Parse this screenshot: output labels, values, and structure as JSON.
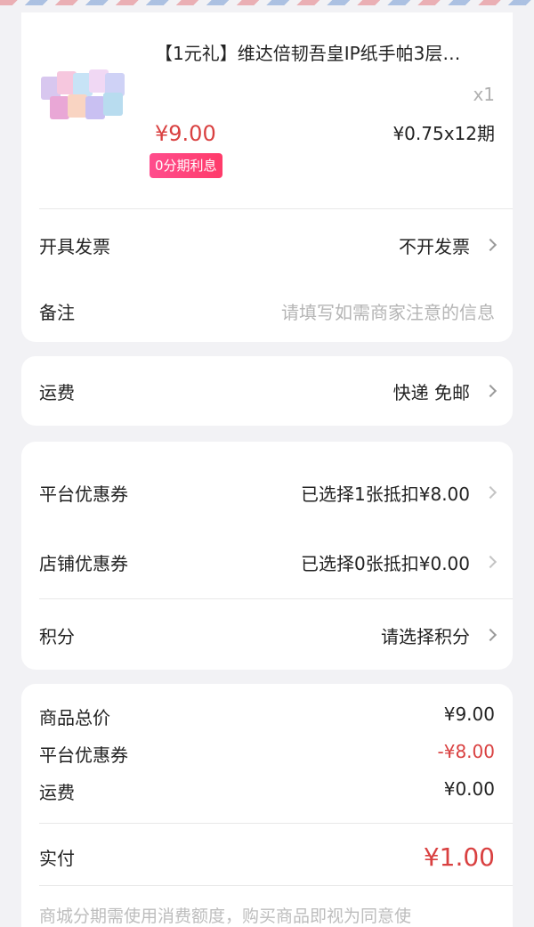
{
  "product": {
    "title": "【1元礼】维达倍韧吾皇IP纸手帕3层…",
    "quantity": "x1",
    "price": "¥9.00",
    "installment": "¥0.75x12期",
    "badge": "0分期利息",
    "image_icon": "tissue-pack-icon"
  },
  "invoice": {
    "label": "开具发票",
    "value": "不开发票"
  },
  "remark": {
    "label": "备注",
    "placeholder": "请填写如需商家注意的信息"
  },
  "shipping": {
    "label": "运费",
    "value": "快递 免邮"
  },
  "coupons": {
    "platform": {
      "label": "平台优惠券",
      "value": "已选择1张抵扣¥8.00"
    },
    "store": {
      "label": "店铺优惠券",
      "value": "已选择0张抵扣¥0.00"
    },
    "points": {
      "label": "积分",
      "value": "请选择积分"
    }
  },
  "summary": {
    "items_total": {
      "label": "商品总价",
      "value": "¥9.00"
    },
    "platform_coupon": {
      "label": "平台优惠券",
      "value": "-¥8.00"
    },
    "shipping": {
      "label": "运费",
      "value": "¥0.00"
    },
    "paid": {
      "label": "实付",
      "value": "¥1.00"
    },
    "notice": "商城分期需使用消费额度，购买商品即视为同意使"
  },
  "colors": {
    "price_red": "#d94040",
    "badge_pink": "#ff4d8d",
    "background": "#f2f2f5"
  }
}
